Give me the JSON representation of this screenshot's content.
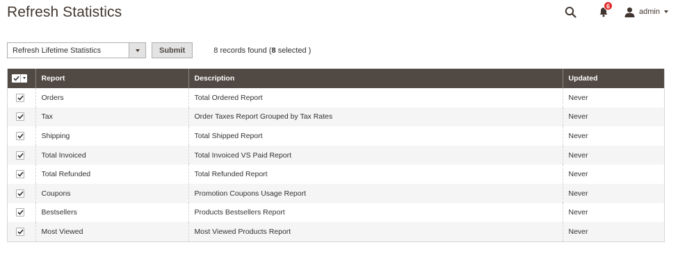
{
  "page": {
    "title": "Refresh Statistics"
  },
  "header": {
    "search_icon": "search-icon",
    "notifications": {
      "icon": "bell-icon",
      "count": "6",
      "badge_color": "#e22626"
    },
    "user": {
      "name": "admin",
      "icon": "user-icon"
    }
  },
  "actions": {
    "select_value": "Refresh Lifetime Statistics",
    "submit_label": "Submit",
    "records": {
      "prefix": "8 records found (",
      "selected_count": "8",
      "suffix": " selected )"
    }
  },
  "grid": {
    "columns": [
      "Report",
      "Description",
      "Updated"
    ],
    "header_color": "#514943",
    "rows": [
      {
        "report": "Orders",
        "description": "Total Ordered Report",
        "updated": "Never",
        "checked": true
      },
      {
        "report": "Tax",
        "description": "Order Taxes Report Grouped by Tax Rates",
        "updated": "Never",
        "checked": true
      },
      {
        "report": "Shipping",
        "description": "Total Shipped Report",
        "updated": "Never",
        "checked": true
      },
      {
        "report": "Total Invoiced",
        "description": "Total Invoiced VS Paid Report",
        "updated": "Never",
        "checked": true
      },
      {
        "report": "Total Refunded",
        "description": "Total Refunded Report",
        "updated": "Never",
        "checked": true
      },
      {
        "report": "Coupons",
        "description": "Promotion Coupons Usage Report",
        "updated": "Never",
        "checked": true
      },
      {
        "report": "Bestsellers",
        "description": "Products Bestsellers Report",
        "updated": "Never",
        "checked": true
      },
      {
        "report": "Most Viewed",
        "description": "Most Viewed Products Report",
        "updated": "Never",
        "checked": true
      }
    ]
  }
}
